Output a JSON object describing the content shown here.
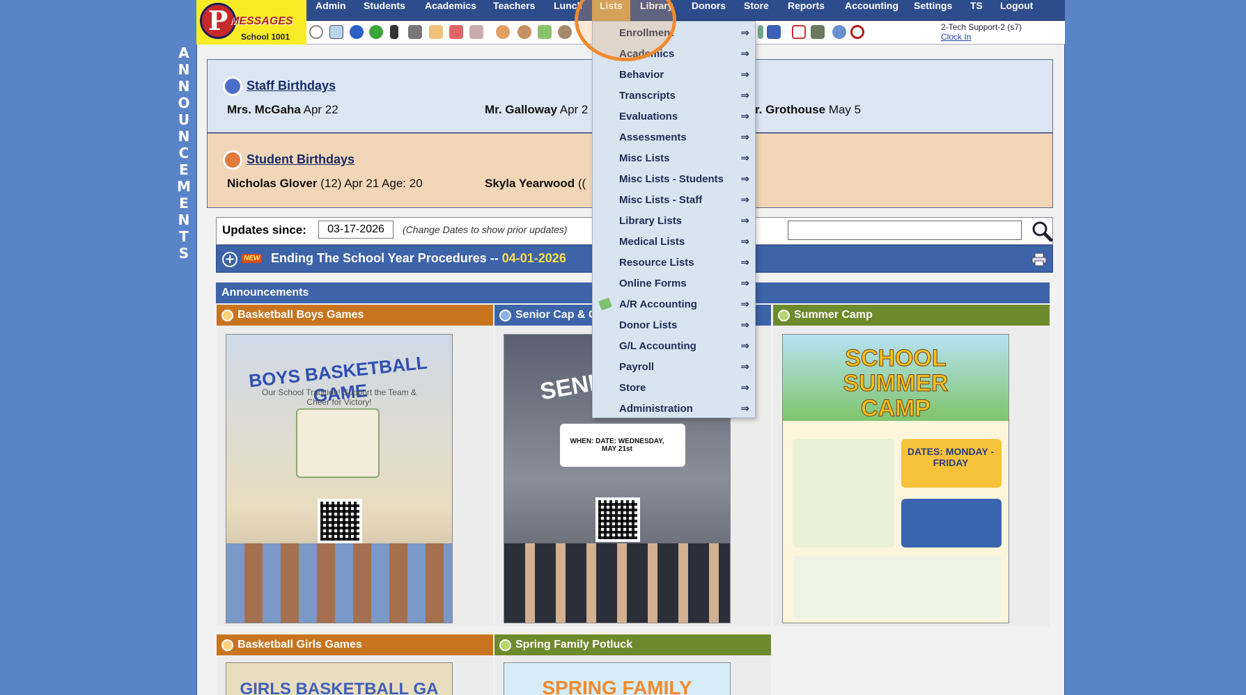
{
  "side_label": "ANNOUNCEMENTS",
  "logo": {
    "letter": "P",
    "brand": "MESSAGES",
    "school": "School 1001"
  },
  "nav": {
    "items": [
      {
        "label": "Admin"
      },
      {
        "label": "Students"
      },
      {
        "label": "Academics"
      },
      {
        "label": "Teachers"
      },
      {
        "label": "Lunch"
      },
      {
        "label": "Lists"
      },
      {
        "label": "Library"
      },
      {
        "label": "Donors"
      },
      {
        "label": "Store"
      },
      {
        "label": "Reports"
      },
      {
        "label": "Accounting"
      },
      {
        "label": "Settings"
      },
      {
        "label": "TS"
      },
      {
        "label": "Logout"
      }
    ],
    "active": "Lists"
  },
  "user": {
    "name": "2-Tech Support-2 (s7)",
    "clock_link": "Clock In"
  },
  "staff_birthdays": {
    "title": "Staff Birthdays",
    "entries": [
      {
        "name": "Mrs. McGaha",
        "date": "Apr 22"
      },
      {
        "name": "Mr. Galloway",
        "date": "Apr 2"
      },
      {
        "name": "r. Grothouse",
        "date": "May 5"
      }
    ]
  },
  "student_birthdays": {
    "title": "Student Birthdays",
    "entries": [
      {
        "name": "Nicholas Glover",
        "detail": "(12) Apr 21 Age: 20"
      },
      {
        "name": "Skyla Yearwood",
        "detail": "(("
      }
    ]
  },
  "updates": {
    "label": "Updates since:",
    "date": "03-17-2026",
    "hint": "(Change Dates to show prior updates)",
    "search_placeholder": ""
  },
  "procedure": {
    "badge": "NEW",
    "title": "Ending The School Year Procedures -- ",
    "date": "04-01-2026"
  },
  "announcements": {
    "heading": "Announcements",
    "cards": [
      {
        "title": "Basketball Boys Games",
        "color": "#c8741f",
        "poster_title": "BOYS BASKETBALL GAME",
        "poster_sub": "Our School Tradition! Support the Team & Cheer for Victory!"
      },
      {
        "title": "Senior Cap & G",
        "color": "#3d63a8",
        "poster_title": "SENIOR PICT",
        "poster_sub": "WHEN: DATE: WEDNESDAY, MAY 21st"
      },
      {
        "title": "Summer Camp",
        "color": "#6d8a2c",
        "poster_title": "SCHOOL SUMMER CAMP",
        "poster_sub": "DATES: MONDAY - FRIDAY"
      },
      {
        "title": "Basketball Girls Games",
        "color": "#c8741f",
        "poster_title": "GIRLS BASKETBALL GA"
      },
      {
        "title": "Spring Family Potluck",
        "color": "#6d8a2c",
        "poster_title": "SPRING FAMILY"
      }
    ]
  },
  "lists_menu": {
    "items": [
      {
        "label": "Enrollment"
      },
      {
        "label": "Academics"
      },
      {
        "label": "Behavior"
      },
      {
        "label": "Transcripts"
      },
      {
        "label": "Evaluations"
      },
      {
        "label": "Assessments"
      },
      {
        "label": "Misc Lists"
      },
      {
        "label": "Misc Lists - Students"
      },
      {
        "label": "Misc Lists - Staff"
      },
      {
        "label": "Library Lists"
      },
      {
        "label": "Medical Lists"
      },
      {
        "label": "Resource Lists"
      },
      {
        "label": "Online Forms"
      },
      {
        "label": "A/R Accounting"
      },
      {
        "label": "Donor Lists"
      },
      {
        "label": "G/L Accounting"
      },
      {
        "label": "Payroll"
      },
      {
        "label": "Store"
      },
      {
        "label": "Administration"
      }
    ],
    "arrow": "⇒"
  },
  "colors": {
    "nav_bg": "#2d4c8c",
    "accent_orange": "#f28a2c",
    "menu_bg": "#d9e4f1"
  }
}
